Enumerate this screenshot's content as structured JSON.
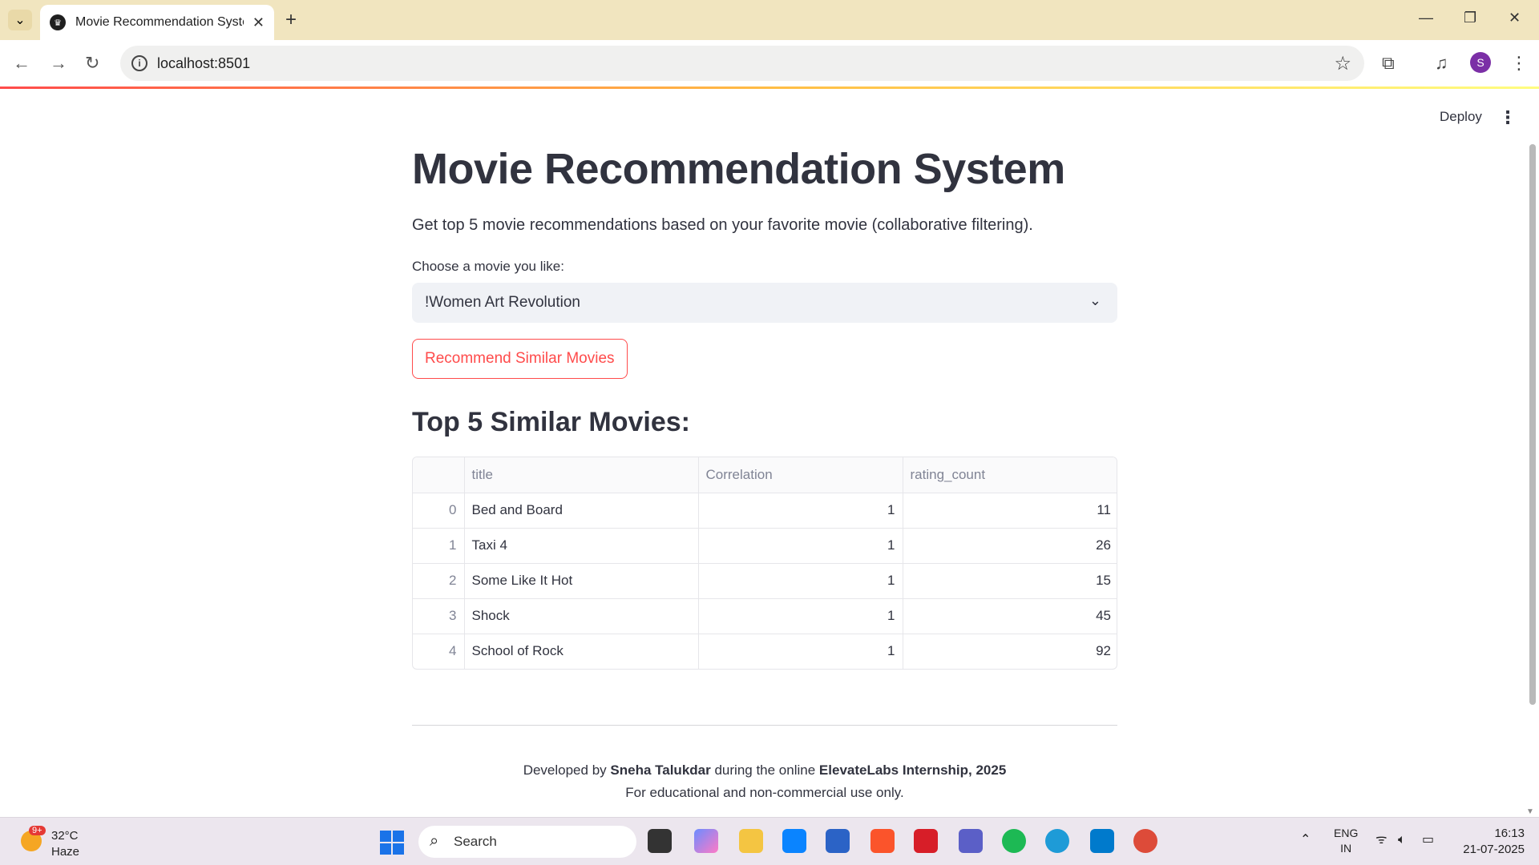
{
  "browser": {
    "tab_title": "Movie Recommendation System",
    "url": "localhost:8501"
  },
  "app": {
    "deploy_label": "Deploy",
    "title": "Movie Recommendation System",
    "subtitle": "Get top 5 movie recommendations based on your favorite movie (collaborative filtering).",
    "select_label": "Choose a movie you like:",
    "select_value": "!Women Art Revolution",
    "button_label": "Recommend Similar Movies",
    "results_heading": "Top 5 Similar Movies:",
    "table": {
      "columns": [
        "",
        "title",
        "Correlation",
        "rating_count"
      ],
      "rows": [
        {
          "index": "0",
          "title": "Bed and Board",
          "correlation": "1",
          "rating_count": "11"
        },
        {
          "index": "1",
          "title": "Taxi 4",
          "correlation": "1",
          "rating_count": "26"
        },
        {
          "index": "2",
          "title": "Some Like It Hot",
          "correlation": "1",
          "rating_count": "15"
        },
        {
          "index": "3",
          "title": "Shock",
          "correlation": "1",
          "rating_count": "45"
        },
        {
          "index": "4",
          "title": "School of Rock",
          "correlation": "1",
          "rating_count": "92"
        }
      ]
    },
    "footer": {
      "prefix": "Developed by",
      "author": "Sneha Talukdar",
      "middle": "during the online",
      "org": "ElevateLabs Internship, 2025",
      "line2": "For educational and non-commercial use only."
    }
  },
  "taskbar": {
    "weather_badge": "9+",
    "temperature": "32°C",
    "condition": "Haze",
    "search_label": "Search",
    "lang_top": "ENG",
    "lang_bottom": "IN",
    "time": "16:13",
    "date": "21-07-2025"
  },
  "colors": {
    "accent": "#ff4b4b",
    "text": "#31333f",
    "tab_bar": "#f1e5bf"
  }
}
